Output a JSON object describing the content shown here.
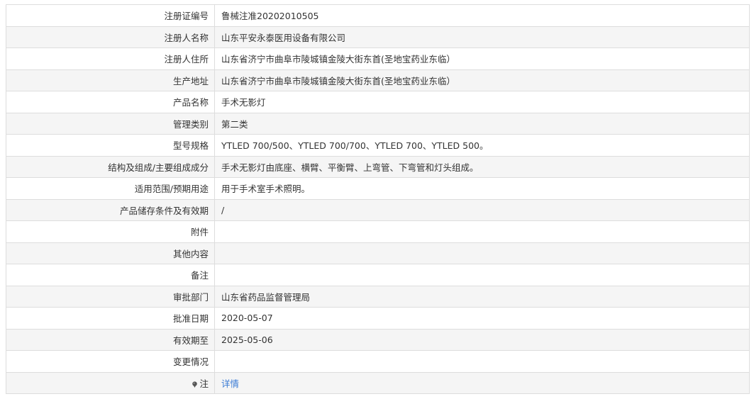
{
  "rows": [
    {
      "label": "注册证编号",
      "value": "鲁械注准20202010505"
    },
    {
      "label": "注册人名称",
      "value": "山东平安永泰医用设备有限公司"
    },
    {
      "label": "注册人住所",
      "value": "山东省济宁市曲阜市陵城镇金陵大街东首(圣地宝药业东临）"
    },
    {
      "label": "生产地址",
      "value": "山东省济宁市曲阜市陵城镇金陵大街东首(圣地宝药业东临）"
    },
    {
      "label": "产品名称",
      "value": "手术无影灯"
    },
    {
      "label": "管理类别",
      "value": "第二类"
    },
    {
      "label": "型号规格",
      "value": "YTLED 700/500、YTLED 700/700、YTLED 700、YTLED 500。"
    },
    {
      "label": "结构及组成/主要组成成分",
      "value": "手术无影灯由底座、横臂、平衡臂、上弯管、下弯管和灯头组成。"
    },
    {
      "label": "适用范围/预期用途",
      "value": "用于手术室手术照明。"
    },
    {
      "label": "产品储存条件及有效期",
      "value": "/"
    },
    {
      "label": "附件",
      "value": ""
    },
    {
      "label": "其他内容",
      "value": ""
    },
    {
      "label": "备注",
      "value": ""
    },
    {
      "label": "审批部门",
      "value": "山东省药品监督管理局"
    },
    {
      "label": "批准日期",
      "value": "2020-05-07"
    },
    {
      "label": "有效期至",
      "value": "2025-05-06"
    },
    {
      "label": "变更情况",
      "value": ""
    }
  ],
  "note_row": {
    "icon": "pin-icon",
    "label": "注",
    "link_text": "详情",
    "link_color": "#3a7bd5"
  }
}
